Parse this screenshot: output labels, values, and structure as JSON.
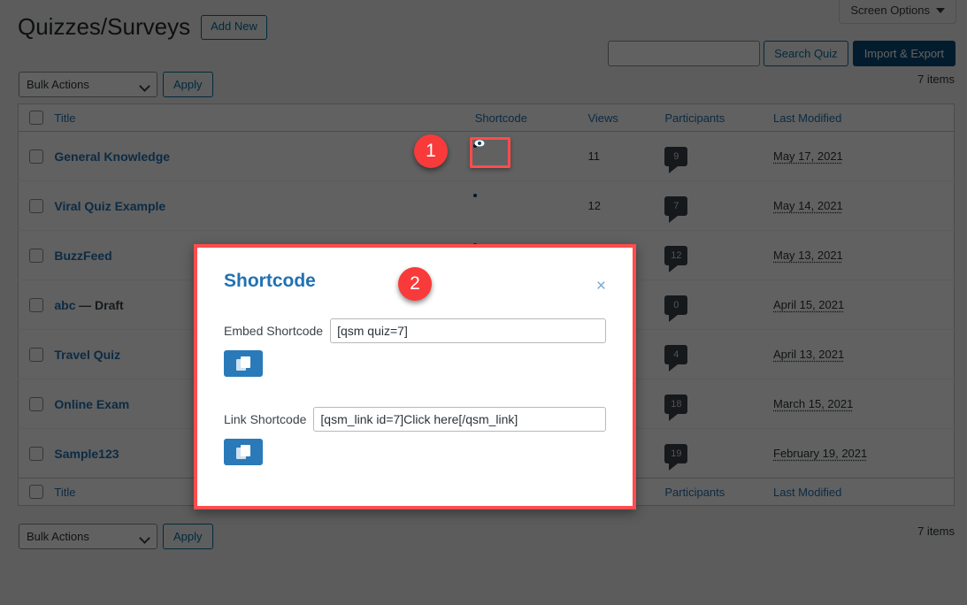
{
  "header": {
    "screen_options_label": "Screen Options",
    "page_title": "Quizzes/Surveys",
    "add_new_label": "Add New"
  },
  "search": {
    "value": "",
    "placeholder": "",
    "search_button_label": "Search Quiz",
    "import_export_label": "Import & Export"
  },
  "tablenav": {
    "bulk_actions_label": "Bulk Actions",
    "apply_label": "Apply",
    "items_count": "7 items"
  },
  "table": {
    "columns": {
      "title": "Title",
      "shortcode": "Shortcode",
      "views": "Views",
      "participants": "Participants",
      "last_modified": "Last Modified"
    },
    "rows": [
      {
        "title": "General Knowledge",
        "suffix": "",
        "views": "11",
        "participants": "9",
        "last_modified": "May 17, 2021",
        "shortcode_icon": "monitor-eye-icon",
        "highlighted": true
      },
      {
        "title": "Viral Quiz Example",
        "suffix": "",
        "views": "12",
        "participants": "7",
        "last_modified": "May 14, 2021",
        "shortcode_icon": "monitor-eye-icon",
        "highlighted": false
      },
      {
        "title": "BuzzFeed",
        "suffix": "",
        "views": "",
        "participants": "12",
        "last_modified": "May 13, 2021",
        "shortcode_icon": "monitor-eye-icon",
        "highlighted": false
      },
      {
        "title": "abc",
        "suffix": "— Draft",
        "views": "",
        "participants": "0",
        "last_modified": "April 15, 2021",
        "shortcode_icon": "monitor-eye-icon",
        "highlighted": false
      },
      {
        "title": "Travel Quiz",
        "suffix": "",
        "views": "",
        "participants": "4",
        "last_modified": "April 13, 2021",
        "shortcode_icon": "monitor-eye-icon",
        "highlighted": false
      },
      {
        "title": "Online Exam",
        "suffix": "",
        "views": "",
        "participants": "18",
        "last_modified": "March 15, 2021",
        "shortcode_icon": "monitor-eye-icon",
        "highlighted": false
      },
      {
        "title": "Sample123",
        "suffix": "",
        "views": "",
        "participants": "19",
        "last_modified": "February 19, 2021",
        "shortcode_icon": "monitor-eye-icon",
        "highlighted": false
      }
    ]
  },
  "modal": {
    "title": "Shortcode",
    "close_label": "×",
    "embed": {
      "label": "Embed Shortcode",
      "value": "[qsm quiz=7]",
      "copy_icon": "copy-icon"
    },
    "link": {
      "label": "Link Shortcode",
      "value": "[qsm_link id=7]Click here[/qsm_link]",
      "copy_icon": "copy-icon"
    }
  },
  "annotations": {
    "step1": "1",
    "step2": "2"
  },
  "colors": {
    "accent_blue": "#2271b1",
    "dark_blue": "#0a4b78",
    "badge_red": "#f93a3a",
    "copy_button_blue": "#2a7ab9",
    "icon_navy": "#0a3d62"
  }
}
